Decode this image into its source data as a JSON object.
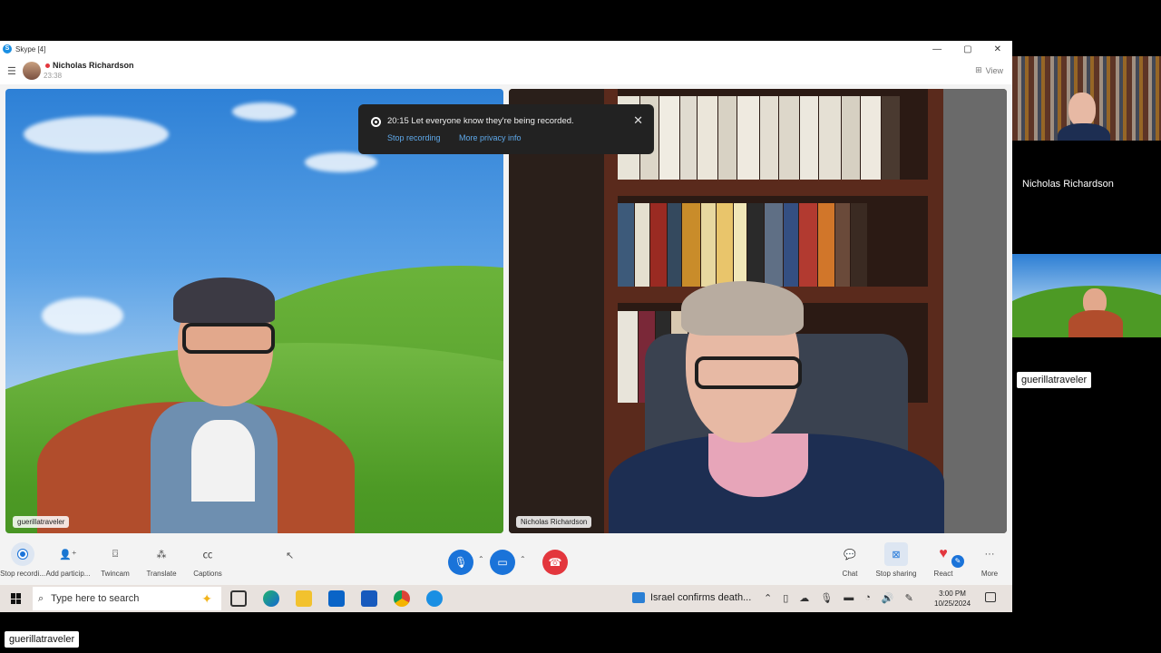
{
  "window": {
    "title": "Skype [4]",
    "minimize": "—",
    "maximize": "▢",
    "close": "✕"
  },
  "call": {
    "participant_name": "Nicholas Richardson",
    "duration": "23:38",
    "view_label": "View"
  },
  "tiles": {
    "left_label": "guerillatraveler",
    "right_label": "Nicholas Richardson"
  },
  "toast": {
    "message": "20:15 Let everyone know they're being recorded.",
    "stop_recording": "Stop recording",
    "privacy_info": "More privacy info"
  },
  "controls": {
    "stop_recording": "Stop recordi...",
    "add_participants": "Add particip...",
    "twincam": "Twincam",
    "translate": "Translate",
    "captions": "Captions",
    "chat": "Chat",
    "stop_sharing": "Stop sharing",
    "react": "React",
    "more": "More",
    "colors": {
      "mic": "#1a73d9",
      "camera": "#1a73d9",
      "hangup": "#e3363d"
    }
  },
  "taskbar": {
    "search_placeholder": "Type here to search",
    "news": "Israel confirms death...",
    "time": "3:00 PM",
    "date": "10/25/2024"
  },
  "side": {
    "participant_top_name": "Nicholas Richardson",
    "participant_bottom_chip": "guerillatraveler",
    "bottom_left_chip": "guerillatraveler"
  }
}
